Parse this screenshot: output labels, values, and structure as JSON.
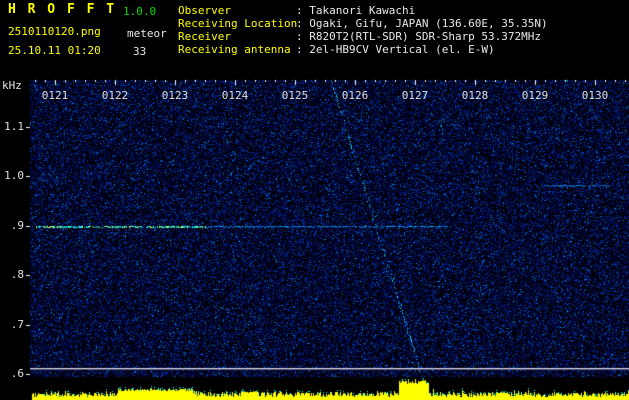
{
  "header": {
    "app_name": "H R O F F T",
    "version": "1.0.0",
    "filename": "2510110120.png",
    "mode": "meteor",
    "datetime": "25.10.11 01:20",
    "count": "33",
    "info": [
      {
        "label": "Observer",
        "value": ": Takanori Kawachi"
      },
      {
        "label": "Receiving Location",
        "value": ": Ogaki, Gifu, JAPAN (136.60E, 35.35N)"
      },
      {
        "label": "Receiver",
        "value": ": R820T2(RTL-SDR) SDR-Sharp 53.372MHz"
      },
      {
        "label": "Receiving antenna",
        "value": ": 2el-HB9CV Vertical (el. E-W)"
      }
    ]
  },
  "chart_data": {
    "type": "heatmap",
    "title": "HROFFT radio meteor observation spectrogram",
    "x_axis": {
      "unit": "HHMM",
      "start": "0120",
      "end": "0130",
      "minutes_per_div": 1,
      "ticks": [
        "0121",
        "0122",
        "0123",
        "0124",
        "0125",
        "0126",
        "0127",
        "0128",
        "0129",
        "0130"
      ]
    },
    "y_axis": {
      "unit": "kHz",
      "range": [
        0.6,
        1.2
      ],
      "ticks": [
        "1.1",
        "1.0",
        ".9",
        ".8",
        ".7",
        ".6"
      ]
    },
    "features": [
      {
        "kind": "carrier",
        "khz": 0.9,
        "t0": 0.68,
        "t1": 7.55,
        "bright_t0": 0.68,
        "bright_t1": 3.5
      },
      {
        "kind": "carrier",
        "khz": 0.982,
        "t0": 9.15,
        "t1": 10.25
      },
      {
        "kind": "streak",
        "t0": 5.6,
        "khz0": 1.195,
        "t1": 7.1,
        "khz1": 0.6
      },
      {
        "kind": "hline",
        "khz": 0.612
      }
    ],
    "bottom_panel": {
      "type": "bar",
      "description": "signal strength vs time",
      "bursts": [
        {
          "t": 2.05,
          "dur": 1.25,
          "level": 0.55
        },
        {
          "t": 4.1,
          "dur": 0.3,
          "level": 0.45
        },
        {
          "t": 6.72,
          "dur": 0.5,
          "level": 1.0
        },
        {
          "t": 8.35,
          "dur": 0.2,
          "level": 0.4
        }
      ]
    },
    "colors": {
      "noise_blue": "#0033cc",
      "carrier_cyan": "#00e5ff",
      "bars_yellow": "#ffff00",
      "bar_tips_cyan": "#00ffff",
      "text_yellow": "#ffff00",
      "text_white": "#e8e8e8",
      "version_green": "#00dd00"
    }
  }
}
